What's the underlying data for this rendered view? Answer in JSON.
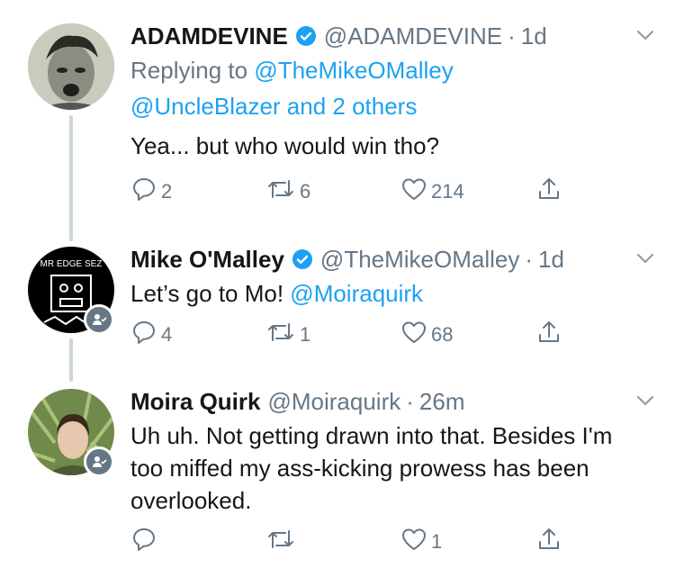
{
  "tweets": [
    {
      "name": "ADAMDEVINE",
      "verified": true,
      "handle": "@ADAMDEVINE",
      "dot": "·",
      "time": "1d",
      "reply_prefix": "Replying to ",
      "reply_user": "@TheMikeOMalley",
      "reply_others": "@UncleBlazer and 2 others",
      "text": "Yea... but who would win tho?",
      "replies": "2",
      "retweets": "6",
      "likes": "214"
    },
    {
      "name": "Mike O'Malley",
      "verified": true,
      "handle": "@TheMikeOMalley",
      "dot": "·",
      "time": "1d",
      "text_pre": "Let’s go to Mo! ",
      "text_mention": "@Moiraquirk",
      "avatar_text": "MR EDGE SEZ",
      "replies": "4",
      "retweets": "1",
      "likes": "68"
    },
    {
      "name": "Moira Quirk",
      "verified": false,
      "handle": "@Moiraquirk",
      "dot": "·",
      "time": "26m",
      "text": "Uh uh. Not getting drawn into that. Besides I'm too miffed my ass-kicking prowess has been overlooked.",
      "replies": "",
      "retweets": "",
      "likes": "1"
    }
  ],
  "colors": {
    "link": "#1da1f2",
    "secondary": "#657786",
    "verified": "#1da1f2",
    "thread_line": "#ccd6dd"
  },
  "icons": [
    "verified-icon",
    "chevron-down-icon",
    "reply-icon",
    "retweet-icon",
    "like-icon",
    "share-icon",
    "follow-badge-icon"
  ]
}
